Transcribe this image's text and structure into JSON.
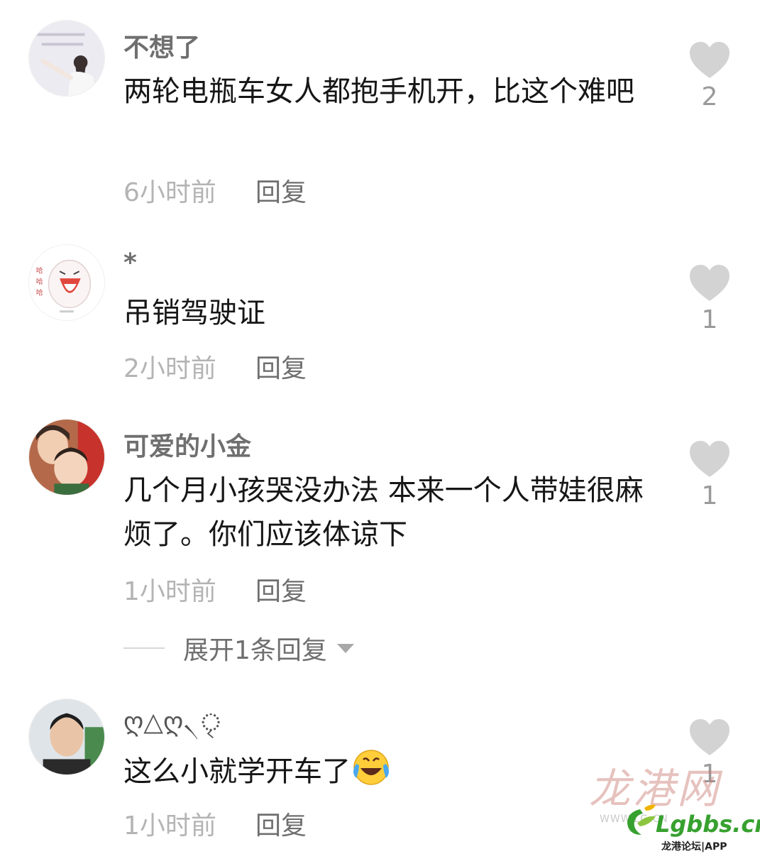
{
  "comments": [
    {
      "username": "不想了",
      "text": "两轮电瓶车女人都抱手机开，比这个难吧",
      "time": "6小时前",
      "reply": "回复",
      "likes": "2",
      "avatar": "avatar-girl-photo"
    },
    {
      "username": "*",
      "text": "吊销驾驶证",
      "time": "2小时前",
      "reply": "回复",
      "likes": "1",
      "avatar": "avatar-laughing-cartoon"
    },
    {
      "username": "可爱的小金",
      "text": "几个月小孩哭没办法 本来一个人带娃很麻烦了。你们应该体谅下",
      "time": "1小时前",
      "reply": "回复",
      "likes": "1",
      "avatar": "avatar-mother-child-photo",
      "expand": "展开1条回复"
    },
    {
      "username": "ღ△ღ৲ৃ",
      "text": "这么小就学开车了",
      "time": "1小时前",
      "reply": "回复",
      "likes": "1",
      "avatar": "avatar-young-man-photo",
      "emoji": "laugh-cry-emoji"
    }
  ],
  "watermark": {
    "site_cn": "龙港网",
    "site_url": "WWW.LG.CN",
    "brand": "Lgbbs.cn",
    "brand_sub": "龙港论坛|APP"
  },
  "colors": {
    "username": "#6f6f6f",
    "text": "#161616",
    "meta": "#b4b4b4",
    "heart": "#d3d3d3",
    "brand_green": "#37a12f"
  }
}
